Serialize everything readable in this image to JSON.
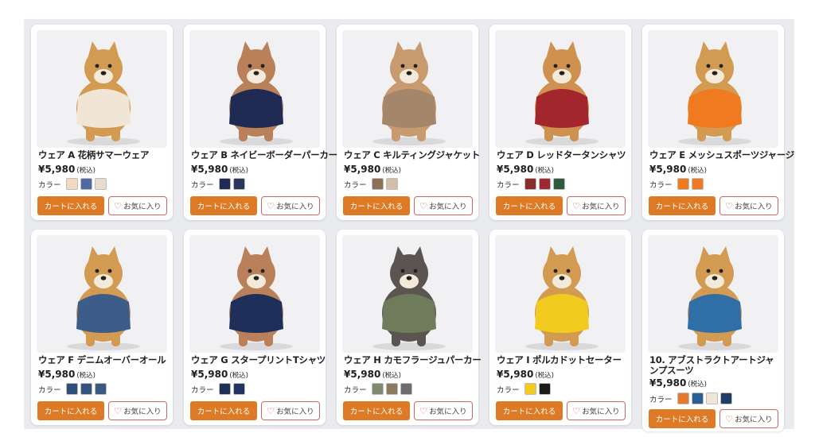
{
  "products": [
    {
      "name": "ウェア A 花柄サマーウェア",
      "price": "¥5,980",
      "tax": "(税込)",
      "color_label": "カラー",
      "dog_color": "#d39a52",
      "outfit_color": "#f1e6d6",
      "swatches": [
        "#f3d9c0",
        "#4f6aa3",
        "#e9dccc"
      ]
    },
    {
      "name": "ウェア B ネイビーボーダーパーカー",
      "price": "¥5,980",
      "tax": "(税込)",
      "color_label": "カラー",
      "dog_color": "#b9805a",
      "outfit_color": "#1f2b52",
      "swatches": [
        "#1f2b52",
        "#2a3660"
      ]
    },
    {
      "name": "ウェア C キルティングジャケット",
      "price": "¥5,980",
      "tax": "(税込)",
      "color_label": "カラー",
      "dog_color": "#c79a70",
      "outfit_color": "#a4866a",
      "swatches": [
        "#8e7057",
        "#d2bfa6"
      ]
    },
    {
      "name": "ウェア D レッドタータンシャツ",
      "price": "¥5,980",
      "tax": "(税込)",
      "color_label": "カラー",
      "dog_color": "#cf9150",
      "outfit_color": "#a3262c",
      "swatches": [
        "#8a2c2a",
        "#9c2b31",
        "#2f5b3c"
      ]
    },
    {
      "name": "ウェア E メッシュスポーツジャージ",
      "price": "¥5,980",
      "tax": "(税込)",
      "color_label": "カラー",
      "dog_color": "#d39a52",
      "outfit_color": "#ef7a1f",
      "swatches": [
        "#ef7a1f",
        "#f07a24"
      ]
    },
    {
      "name": "ウェア F デニムオーバーオール",
      "price": "¥5,980",
      "tax": "(税込)",
      "color_label": "カラー",
      "dog_color": "#d39a52",
      "outfit_color": "#3c5d8a",
      "swatches": [
        "#2f4e7a",
        "#34547f",
        "#3b5a83"
      ]
    },
    {
      "name": "ウェア G スタープリントTシャツ",
      "price": "¥5,980",
      "tax": "(税込)",
      "color_label": "カラー",
      "dog_color": "#b9805a",
      "outfit_color": "#1e2f5a",
      "swatches": [
        "#1e2f5a",
        "#213363"
      ]
    },
    {
      "name": "ウェア H カモフラージュパーカー",
      "price": "¥5,980",
      "tax": "(税込)",
      "color_label": "カラー",
      "dog_color": "#5b5552",
      "outfit_color": "#6f7c5b",
      "swatches": [
        "#7f8a70",
        "#8c7a5e",
        "#6c6c6c"
      ]
    },
    {
      "name": "ウェア I ポルカドットセーター",
      "price": "¥5,980",
      "tax": "(税込)",
      "color_label": "カラー",
      "dog_color": "#d39a52",
      "outfit_color": "#f2cb1e",
      "swatches": [
        "#f2cb1e",
        "#1b1b1b"
      ]
    },
    {
      "name": "10. アブストラクトアートジャンプスーツ",
      "price": "¥5,980",
      "tax": "(税込)",
      "color_label": "カラー",
      "dog_color": "#d39a52",
      "outfit_color": "#2f6fa6",
      "swatches": [
        "#e47a2c",
        "#2a5f92",
        "#f0e6d6",
        "#1f3e66"
      ]
    }
  ],
  "buttons": {
    "cart": "カートに入れる",
    "favorite": "お気に入り",
    "heart_icon": "heart-icon"
  }
}
